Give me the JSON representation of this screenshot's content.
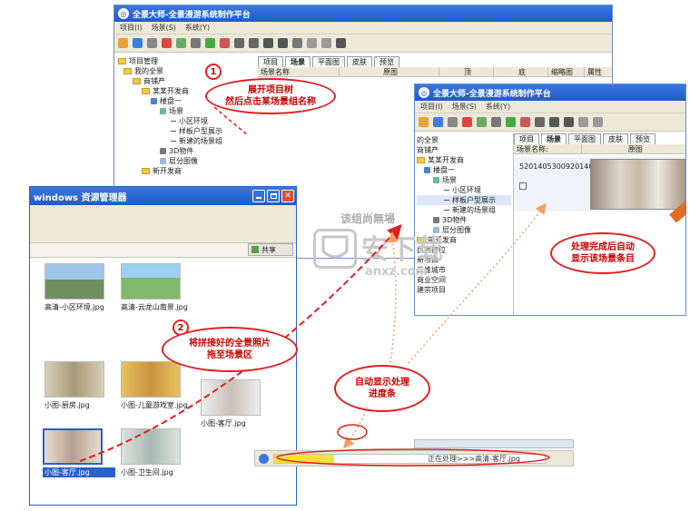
{
  "back_window": {
    "title": "全景大师-全景漫游系统制作平台",
    "menu": [
      "项目(I)",
      "场景(S)",
      "系统(Y)"
    ],
    "tree": {
      "root": "项目管理",
      "items": [
        "我的全景",
        "商铺产",
        "某某开发商",
        "楼盘一",
        "场景",
        "小区环境",
        "样板户型展示",
        "新建的场景组",
        "3D物件",
        "层分图像",
        "新开发商"
      ]
    },
    "tabs": [
      "项目",
      "场景",
      "平面图",
      "皮肤",
      "预览"
    ],
    "columns": [
      "场景名称",
      "原图",
      "顶",
      "底",
      "缩略图",
      "属性"
    ]
  },
  "front_window": {
    "title": "全景大师-全景漫游系统制作平台",
    "menu": [
      "项目(I)",
      "场景(S)",
      "系统(Y)"
    ],
    "tree": {
      "items": [
        "的全景",
        "商铺产",
        "某某开发商",
        "楼盘一",
        "场景",
        "小区环境",
        "样板户型展示",
        "新建的场景组",
        "3D物件",
        "层分图像",
        "新开发商",
        "民地南位",
        "新项目",
        "三维城市",
        "商业空间",
        "建宗项目"
      ]
    },
    "tabs": [
      "项目",
      "场景",
      "平面图",
      "皮肤",
      "预览"
    ],
    "columns": [
      "场景名称:",
      "原图"
    ],
    "scene_id": "5201405300920140",
    "status_text": "正在处理>>>高清-客厅.jpg"
  },
  "explorer": {
    "title": "windows 资源管理器",
    "side_label": "共享",
    "empty_text": "该组尚無場",
    "files": [
      {
        "label": "高清-小区环境.jpg",
        "color": "#6fa6d9"
      },
      {
        "label": "高清-云龙山南景.jpg",
        "color": "#8fc47a"
      },
      {
        "label": "小图-厨房.jpg",
        "color": "#c8b890"
      },
      {
        "label": "小图-儿童游戏室.jpg",
        "color": "#d8b060"
      },
      {
        "label": "小图-客厅.jpg",
        "color": "#d8d2c8"
      },
      {
        "label": "小图-卫生间.jpg",
        "color": "#bfc8c4"
      },
      {
        "label": "小图-客厅.jpg",
        "color": "#cdbfb0"
      }
    ]
  },
  "annotations": {
    "step1_number": "1",
    "step1_text": "展开项目树\n然后点击某场景组名称",
    "step2_number": "2",
    "step2_text": "将拼接好的全景照片\n拖至场景区",
    "auto_done_text": "处理完成后自动\n显示该场景条目",
    "progress_text": "自动显示处理\n进度条"
  },
  "watermark": {
    "big": "安下载",
    "small": "anxz.com"
  }
}
